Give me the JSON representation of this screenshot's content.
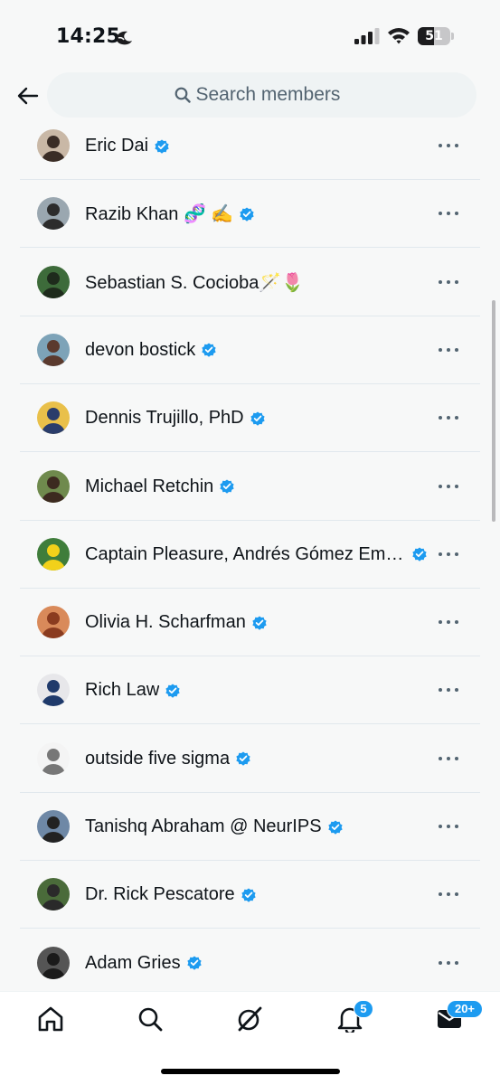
{
  "status_bar": {
    "time": "14:25",
    "battery_level": "51",
    "battery_fraction": 0.51
  },
  "header": {
    "back_icon": "arrow-left-icon",
    "search_placeholder": "Search members",
    "search_icon": "search-icon"
  },
  "members": [
    {
      "name": "Eric Dai",
      "verified": true
    },
    {
      "name": "Razib Khan 🧬 ✍️",
      "verified": true
    },
    {
      "name": "Sebastian S. Cocioba🪄🌷",
      "verified": false
    },
    {
      "name": "devon bostick",
      "verified": true
    },
    {
      "name": "Dennis Trujillo, PhD",
      "verified": true
    },
    {
      "name": "Michael Retchin",
      "verified": true
    },
    {
      "name": "Captain Pleasure, Andrés Gómez Emil...",
      "verified": true
    },
    {
      "name": "Olivia H. Scharfman",
      "verified": true
    },
    {
      "name": "Rich Law",
      "verified": true
    },
    {
      "name": "outside five sigma",
      "verified": true
    },
    {
      "name": "Tanishq Abraham @ NeurIPS",
      "verified": true
    },
    {
      "name": "Dr. Rick Pescatore",
      "verified": true
    },
    {
      "name": "Adam Gries",
      "verified": true
    }
  ],
  "bottom_nav": {
    "items": [
      "home-icon",
      "search-icon",
      "grok-icon",
      "bell-icon",
      "mail-icon"
    ],
    "notifications_badge": "5",
    "messages_badge": "20+"
  },
  "colors": {
    "accent": "#1d9bf0",
    "text": "#0f1419",
    "secondary_text": "#536471",
    "background": "#f7f8f8"
  }
}
